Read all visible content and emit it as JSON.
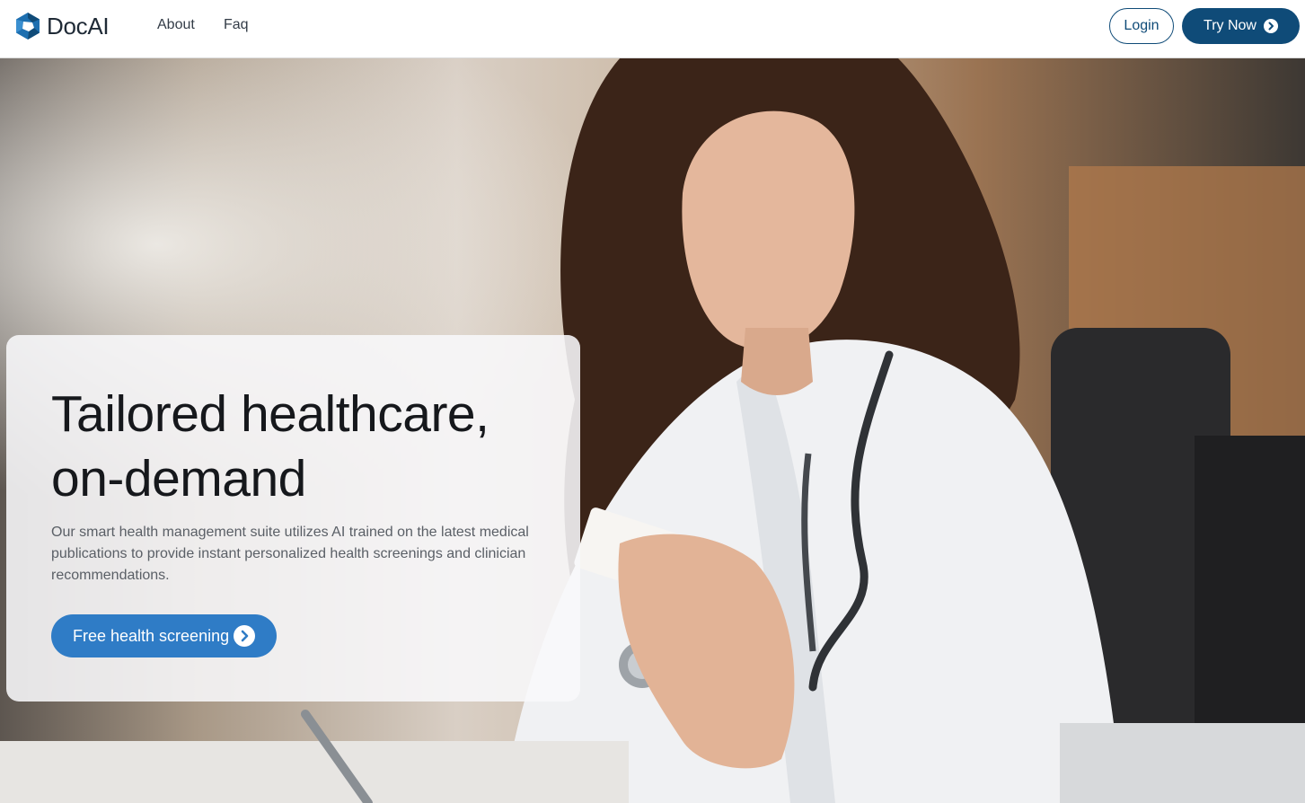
{
  "navbar": {
    "brand_name": "DocAI",
    "links": [
      {
        "label": "About"
      },
      {
        "label": "Faq"
      }
    ],
    "login_label": "Login",
    "try_now_label": "Try Now"
  },
  "hero": {
    "headline": "Tailored healthcare, on-demand",
    "description": "Our smart health management suite utilizes AI trained on the latest medical publications to provide instant personalized health screenings and clinician recommendations.",
    "cta_label": "Free health screening"
  },
  "colors": {
    "brand_dark": "#0f4b78",
    "cta_blue": "#2f7cc6"
  },
  "icons": {
    "logo": "hexagon-aperture-logo-icon",
    "try_now": "chevron-right-circle-icon",
    "cta": "chevron-right-circle-icon"
  }
}
